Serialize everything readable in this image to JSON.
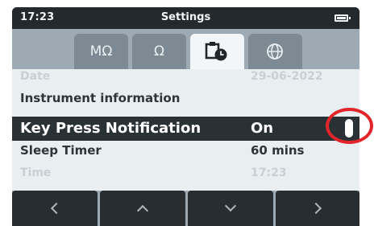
{
  "statusbar": {
    "time": "17:23",
    "title": "Settings",
    "battery_icon": "battery-full-icon"
  },
  "tabs": [
    {
      "label": "MΩ",
      "icon": "megaohm-icon",
      "active": false
    },
    {
      "label": "Ω",
      "icon": "ohm-icon",
      "active": false
    },
    {
      "label": "",
      "icon": "clipboard-clock-icon",
      "active": true
    },
    {
      "label": "",
      "icon": "globe-icon",
      "active": false
    }
  ],
  "settings_list": {
    "rows": [
      {
        "label": "Date",
        "value": "29-06-2022"
      },
      {
        "label": "Instrument information",
        "value": ""
      },
      {
        "label": "Key Press Notification",
        "value": "On",
        "selected": true
      },
      {
        "label": "Sleep Timer",
        "value": "60 mins"
      },
      {
        "label": "Time",
        "value": "17:23"
      }
    ]
  },
  "navbar": {
    "buttons": [
      "chevron-left-icon",
      "chevron-up-icon",
      "chevron-down-icon",
      "chevron-right-icon"
    ]
  },
  "colors": {
    "callout": "#e2252b",
    "selected_row": "#2a3135",
    "tab_active": "#f3f6f8",
    "tab_inactive": "#7e8a93"
  }
}
